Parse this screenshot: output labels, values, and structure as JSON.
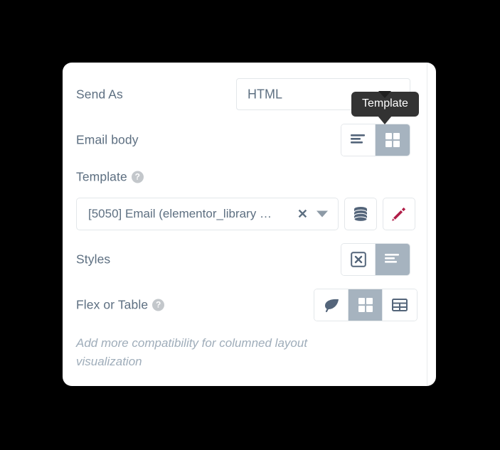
{
  "card": {
    "rows": [
      {
        "id": "send-as",
        "label": "Send As",
        "field_value": "HTML"
      },
      {
        "id": "email-body",
        "label": "Email body",
        "options": [
          {
            "icon": "align-left-icon",
            "active": false
          },
          {
            "icon": "grid-four-icon",
            "active": true
          }
        ]
      },
      {
        "id": "template",
        "label": "Template",
        "help": "?",
        "select_value": "[5050] Email (elementor_library …",
        "clear_label": "✕",
        "buttons": [
          {
            "icon": "database-icon"
          },
          {
            "icon": "pencil-icon"
          }
        ]
      },
      {
        "id": "styles",
        "label": "Styles",
        "options": [
          {
            "icon": "no-style-icon",
            "active": false
          },
          {
            "icon": "align-left-icon",
            "active": true
          }
        ]
      },
      {
        "id": "flex-or-table",
        "label": "Flex or Table",
        "help": "?",
        "options": [
          {
            "icon": "leaf-icon",
            "active": false
          },
          {
            "icon": "grid-four-icon",
            "active": true
          },
          {
            "icon": "table-icon",
            "active": false
          }
        ]
      }
    ],
    "help_text": "Add more compatibility for columned layout visualization"
  },
  "tooltip": {
    "text": "Template"
  },
  "colors": {
    "label": "#5d6f81",
    "active_toggle": "#a6b3bf",
    "pencil": "#b01d47",
    "tooltip_bg": "#333333",
    "help_text": "#9fadba",
    "border": "#e3e7ea"
  }
}
